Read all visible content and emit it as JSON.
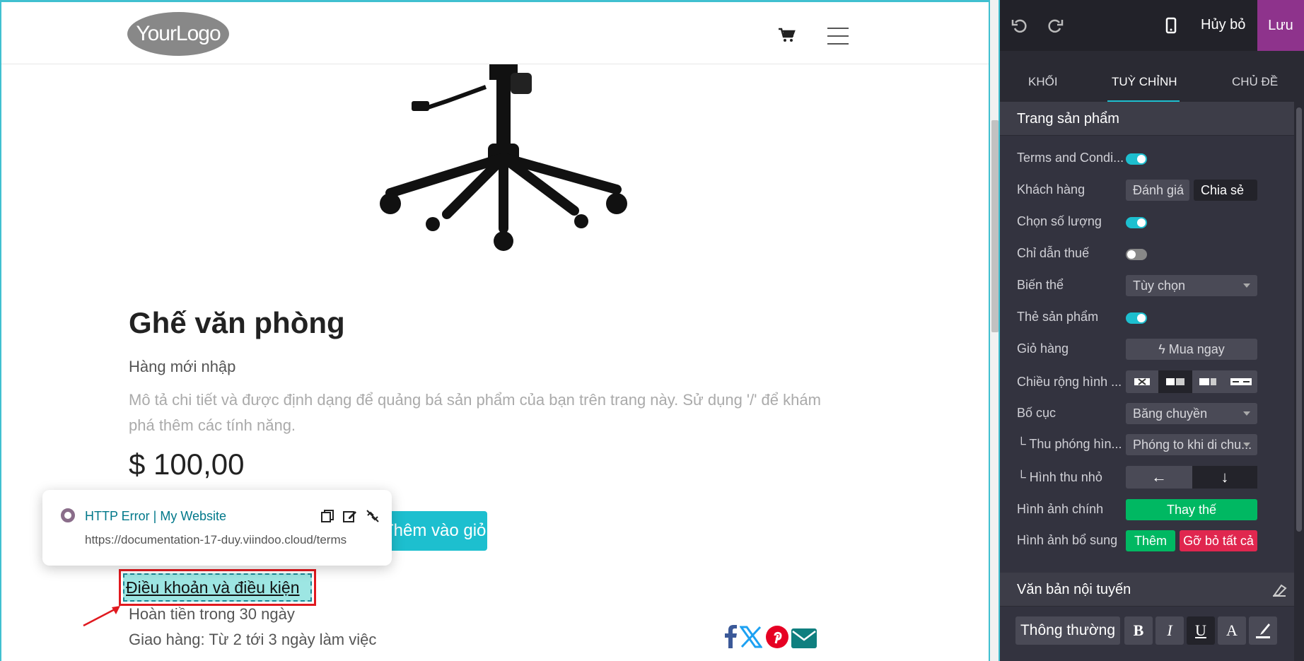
{
  "site": {
    "logo_text": "YourLogo",
    "product": {
      "title": "Ghế văn phòng",
      "subtitle": "Hàng mới nhập",
      "description": "Mô tả chi tiết và được định dạng để quảng bá sản phẩm của bạn trên trang này. Sử dụng '/' để khám phá thêm các tính năng.",
      "price": "$ 100,00",
      "add_to_cart_label": "Thêm vào giỏ hàng",
      "terms_link": "Điều khoản và điều kiện",
      "refund": "Hoàn tiền trong 30 ngày",
      "shipping": "Giao hàng: Từ 2 tới 3 ngày làm việc"
    },
    "link_popover": {
      "title": "HTTP Error | My Website",
      "url": "https://documentation-17-duy.viindoo.cloud/terms"
    },
    "share_icons": [
      "facebook-icon",
      "x-icon",
      "pinterest-icon",
      "email-icon"
    ]
  },
  "editor": {
    "cancel_label": "Hủy bỏ",
    "save_label": "Lưu",
    "tabs": [
      "KHỐI",
      "TUỲ CHỈNH",
      "CHỦ ĐỀ"
    ],
    "active_tab": "TUỲ CHỈNH",
    "section_product": {
      "title": "Trang sản phẩm",
      "rows": {
        "terms": "Terms and Condi...",
        "customer": "Khách hàng",
        "customer_rating": "Đánh giá",
        "customer_share": "Chia sẻ",
        "quantity": "Chọn số lượng",
        "tax": "Chỉ dẫn thuế",
        "variants": "Biến thể",
        "variants_value": "Tùy chọn",
        "tags": "Thẻ sản phẩm",
        "cart": "Giỏ hàng",
        "cart_value": "Mua ngay",
        "image_width": "Chiều rộng hình ...",
        "layout": "Bố cục",
        "layout_value": "Băng chuyền",
        "zoom": "└ Thu phóng hìn...",
        "zoom_value": "Phóng to khi di chu...",
        "thumbnails": "└ Hình thu nhỏ",
        "main_image": "Hình ảnh chính",
        "main_image_btn": "Thay thế",
        "extra_images": "Hình ảnh bổ sung",
        "extra_add": "Thêm",
        "extra_remove": "Gỡ bỏ tất cả"
      },
      "toggles": {
        "terms": true,
        "quantity": true,
        "tax": false,
        "tags": true
      }
    },
    "section_inline": {
      "title": "Văn bản nội tuyến",
      "style_value": "Thông thường",
      "bold": "B",
      "italic": "I",
      "underline": "U",
      "font_color": "A"
    }
  },
  "colors": {
    "accent": "#1dbfcf",
    "save": "#8e338c",
    "panel_bg": "#33333f",
    "success": "#00b862",
    "danger": "#e0274f"
  }
}
